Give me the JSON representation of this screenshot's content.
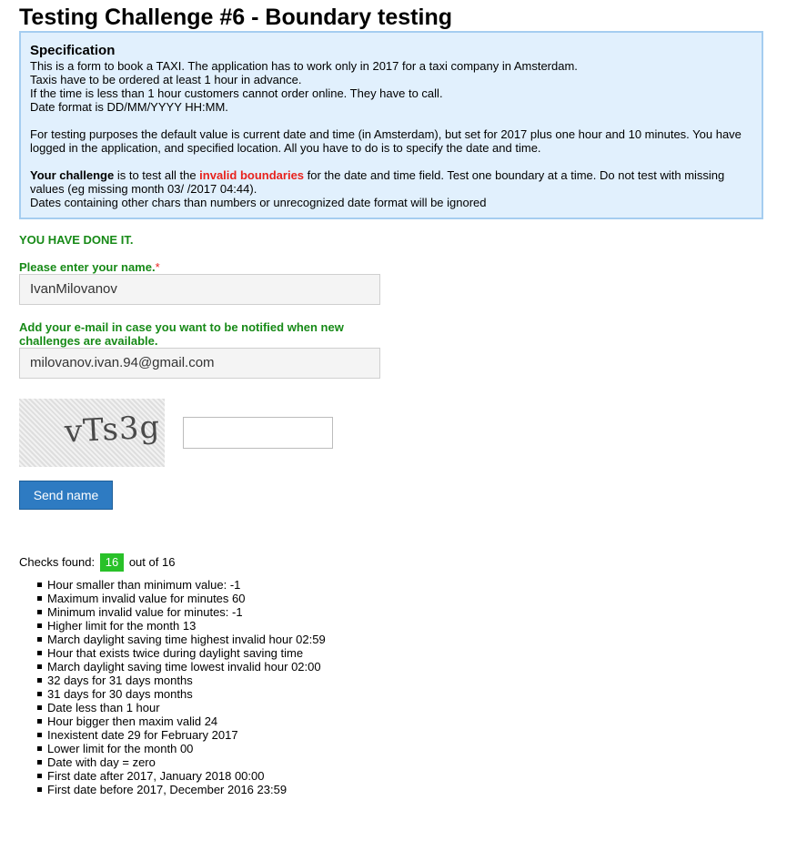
{
  "page": {
    "title": "Testing Challenge #6 - Boundary testing"
  },
  "spec": {
    "heading": "Specification",
    "line1": "This is a form to book a TAXI. The application has to work only in 2017 for a taxi company in Amsterdam.",
    "line2": "Taxis have to be ordered at least 1 hour in advance.",
    "line3": "If the time is less than 1 hour customers cannot order online. They have to call.",
    "line4": "Date format is DD/MM/YYYY HH:MM.",
    "para2": "For testing purposes the default value is current date and time (in Amsterdam), but set for 2017 plus one hour and 10 minutes. You have logged in the application, and specified location. All you have to do is to specify the date and time.",
    "challenge_bold": "Your challenge",
    "challenge_mid": " is to test all the ",
    "challenge_red": "invalid boundaries",
    "challenge_rest": " for the date and time field. Test one boundary at a time. Do not test with missing values (eg missing month 03/ /2017 04:44).",
    "line_last": "Dates containing other chars than numbers or unrecognized date format will be ignored"
  },
  "status": {
    "done_message": "YOU HAVE DONE IT."
  },
  "form": {
    "name_label": "Please enter your name.",
    "required_mark": "*",
    "name_value": "IvanMilovanov",
    "email_label": "Add your e-mail in case you want to be notified when new challenges are available.",
    "email_value": "milovanov.ivan.94@gmail.com",
    "captcha_text": "vTs3g",
    "captcha_input_value": "",
    "send_label": "Send name"
  },
  "checks": {
    "prefix": "Checks found:",
    "found": "16",
    "suffix": "out of 16",
    "items": [
      "Hour smaller than minimum value: -1",
      "Maximum invalid value for minutes 60",
      "Minimum invalid value for minutes: -1",
      "Higher limit for the month 13",
      "March daylight saving time highest invalid hour 02:59",
      "Hour that exists twice during daylight saving time",
      "March daylight saving time lowest invalid hour 02:00",
      "32 days for 31 days months",
      "31 days for 30 days months",
      "Date less than 1 hour",
      "Hour bigger then maxim valid 24",
      "Inexistent date 29 for February 2017",
      "Lower limit for the month 00",
      "Date with day = zero",
      "First date after 2017, January 2018 00:00",
      "First date before 2017, December 2016 23:59"
    ]
  },
  "colors": {
    "label_green": "#178a17",
    "badge_green": "#29c129",
    "spec_bg": "#e1f0fd",
    "button_blue": "#2e7bc2",
    "highlight_red": "#e8221d"
  }
}
